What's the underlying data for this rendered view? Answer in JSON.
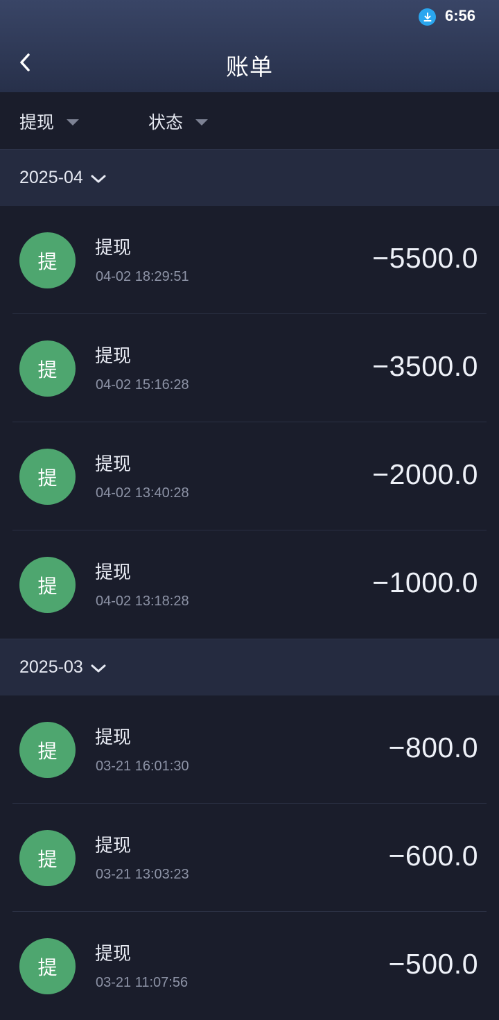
{
  "status_bar": {
    "time": "6:56",
    "icon": "download-icon"
  },
  "header": {
    "back_icon": "chevron-left-icon",
    "title": "账单"
  },
  "filters": [
    {
      "label": "提现",
      "icon": "caret-down-icon"
    },
    {
      "label": "状态",
      "icon": "caret-down-icon"
    }
  ],
  "groups": [
    {
      "month": "2025-04",
      "items": [
        {
          "avatar": "提",
          "title": "提现",
          "time": "04-02 18:29:51",
          "amount": "−5500.0"
        },
        {
          "avatar": "提",
          "title": "提现",
          "time": "04-02 15:16:28",
          "amount": "−3500.0"
        },
        {
          "avatar": "提",
          "title": "提现",
          "time": "04-02 13:40:28",
          "amount": "−2000.0"
        },
        {
          "avatar": "提",
          "title": "提现",
          "time": "04-02 13:18:28",
          "amount": "−1000.0"
        }
      ]
    },
    {
      "month": "2025-03",
      "items": [
        {
          "avatar": "提",
          "title": "提现",
          "time": "03-21 16:01:30",
          "amount": "−800.0"
        },
        {
          "avatar": "提",
          "title": "提现",
          "time": "03-21 13:03:23",
          "amount": "−600.0"
        },
        {
          "avatar": "提",
          "title": "提现",
          "time": "03-21 11:07:56",
          "amount": "−500.0"
        }
      ]
    }
  ],
  "colors": {
    "background": "#1a1d2b",
    "header_gradient_top": "#394566",
    "month_header": "#252b40",
    "avatar": "#4ea66f",
    "secondary_text": "#8d93a6"
  }
}
